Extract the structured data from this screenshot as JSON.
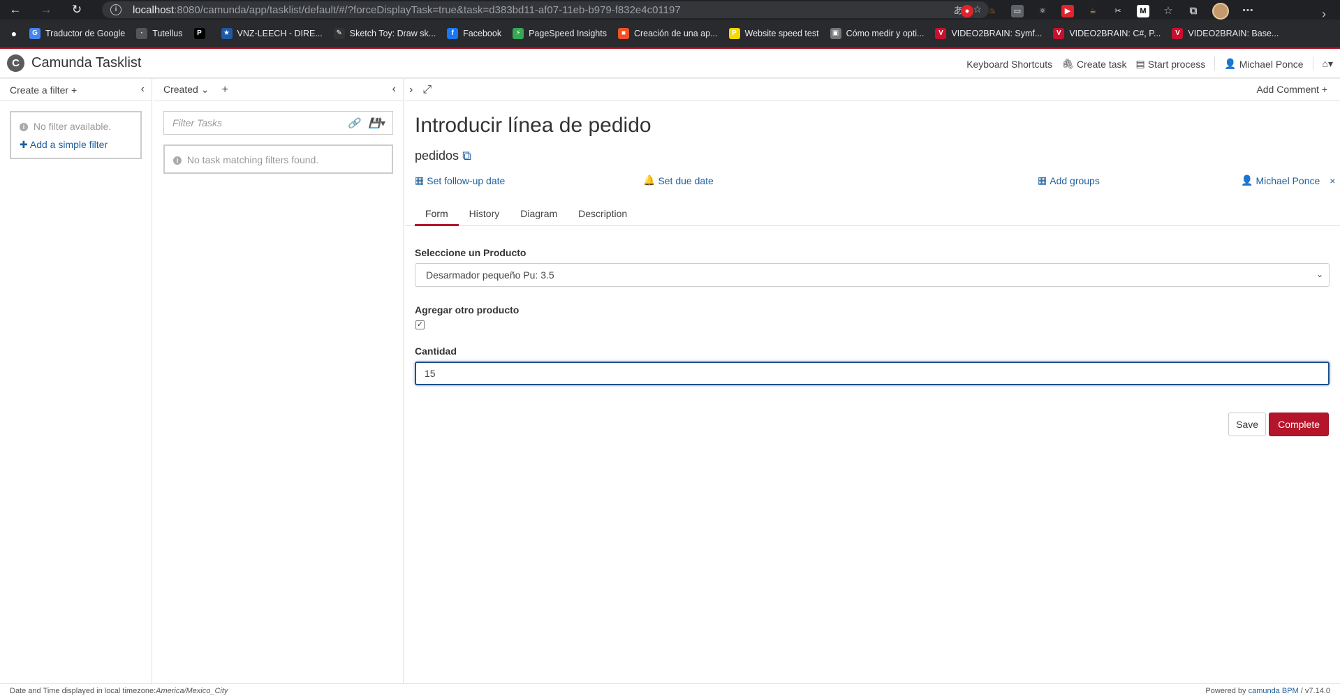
{
  "browser": {
    "url_host": "localhost",
    "url_path": ":8080/camunda/app/tasklist/default/#/?forceDisplayTask=true&task=d383bd11-af07-11eb-b979-f832e4c01197",
    "bookmarks": [
      {
        "label": "Traductor de Google",
        "color": "#4285f4",
        "glyph": "G"
      },
      {
        "label": "Tutellus",
        "color": "#555",
        "glyph": "·"
      },
      {
        "label": "",
        "color": "#000",
        "glyph": "P"
      },
      {
        "label": "VNZ-LEECH - DIRE...",
        "color": "#1e5aa8",
        "glyph": "★"
      },
      {
        "label": "Sketch Toy: Draw sk...",
        "color": "#333",
        "glyph": "✎"
      },
      {
        "label": "Facebook",
        "color": "#1877f2",
        "glyph": "f"
      },
      {
        "label": "PageSpeed Insights",
        "color": "#34a853",
        "glyph": "⚡"
      },
      {
        "label": "Creación de una ap...",
        "color": "#f25022",
        "glyph": "■"
      },
      {
        "label": "Website speed test",
        "color": "#f5d800",
        "glyph": "P"
      },
      {
        "label": "Cómo medir y opti...",
        "color": "#777",
        "glyph": "▣"
      },
      {
        "label": "VIDEO2BRAIN: Symf...",
        "color": "#c8102e",
        "glyph": "V"
      },
      {
        "label": "VIDEO2BRAIN: C#, P...",
        "color": "#c8102e",
        "glyph": "V"
      },
      {
        "label": "VIDEO2BRAIN: Base...",
        "color": "#c8102e",
        "glyph": "V"
      }
    ]
  },
  "app": {
    "title": "Camunda Tasklist",
    "header_links": {
      "shortcuts": "Keyboard Shortcuts",
      "create_task": "Create task",
      "start_process": "Start process",
      "user": "Michael Ponce"
    },
    "accent": "#b5152b"
  },
  "filters": {
    "header": "Create a filter",
    "empty": "No filter available.",
    "add_link": "Add a simple filter"
  },
  "list": {
    "sort_label": "Created",
    "filter_placeholder": "Filter Tasks",
    "empty": "No task matching filters found."
  },
  "task": {
    "add_comment": "Add Comment",
    "title": "Introducir línea de pedido",
    "process": "pedidos",
    "follow_up": "Set follow-up date",
    "due_date": "Set due date",
    "add_groups": "Add groups",
    "assignee": "Michael Ponce",
    "tabs": [
      "Form",
      "History",
      "Diagram",
      "Description"
    ],
    "form": {
      "product_label": "Seleccione un Producto",
      "product_value": "Desarmador pequeño Pu: 3.5",
      "another_label": "Agregar otro producto",
      "another_checked": true,
      "qty_label": "Cantidad",
      "qty_value": "15"
    },
    "save": "Save",
    "complete": "Complete"
  },
  "footer": {
    "tz_text": "Date and Time displayed in local timezone: ",
    "tz_value": "America/Mexico_City",
    "powered": "Powered by ",
    "brand": "camunda BPM",
    "version": " / v7.14.0"
  }
}
